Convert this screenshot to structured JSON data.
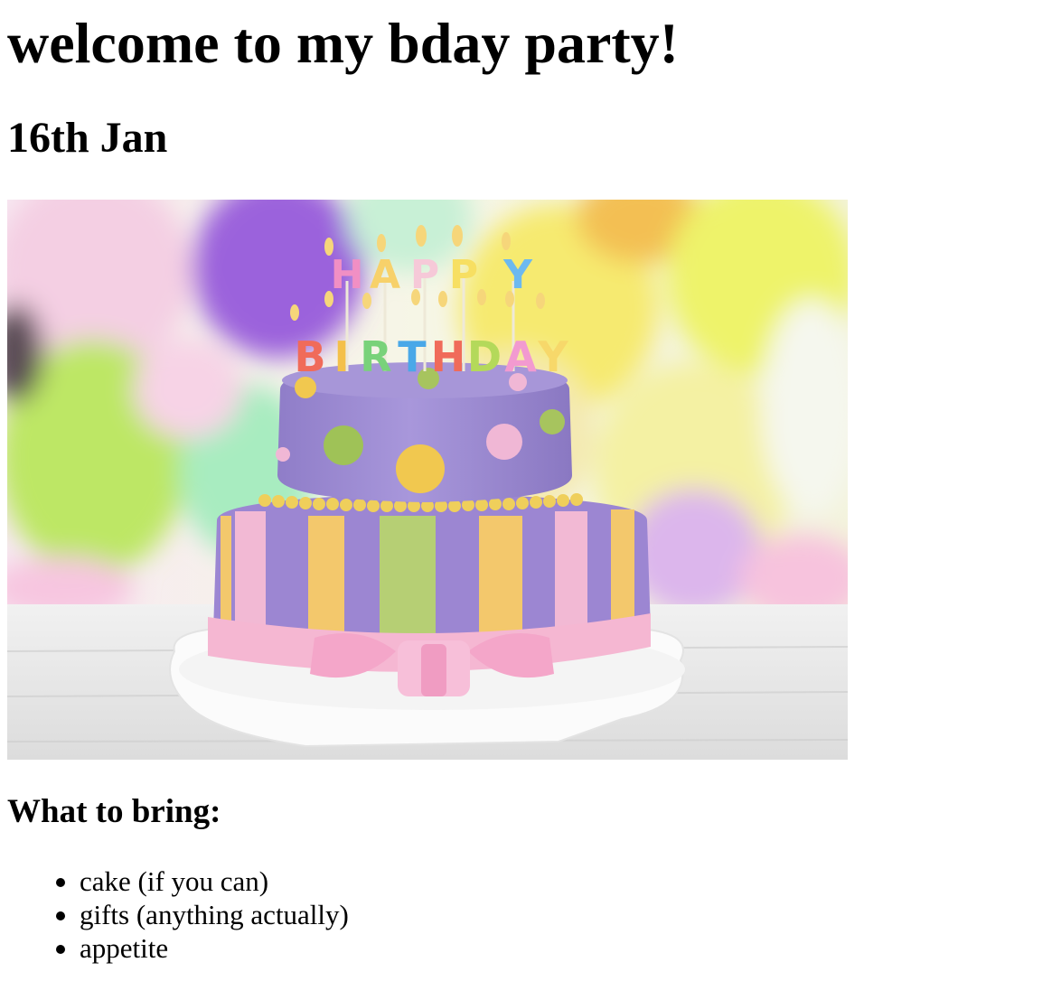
{
  "page": {
    "heading": "welcome to my bday party!",
    "date": "16th Jan",
    "image": {
      "subject": "birthday-cake",
      "candle_text_top": "HAPPY",
      "candle_text_bottom": "BIRTHDAY"
    },
    "bring_heading": "What to bring:",
    "bring_items": [
      "cake (if you can)",
      "gifts (anything actually)",
      "appetite"
    ]
  }
}
